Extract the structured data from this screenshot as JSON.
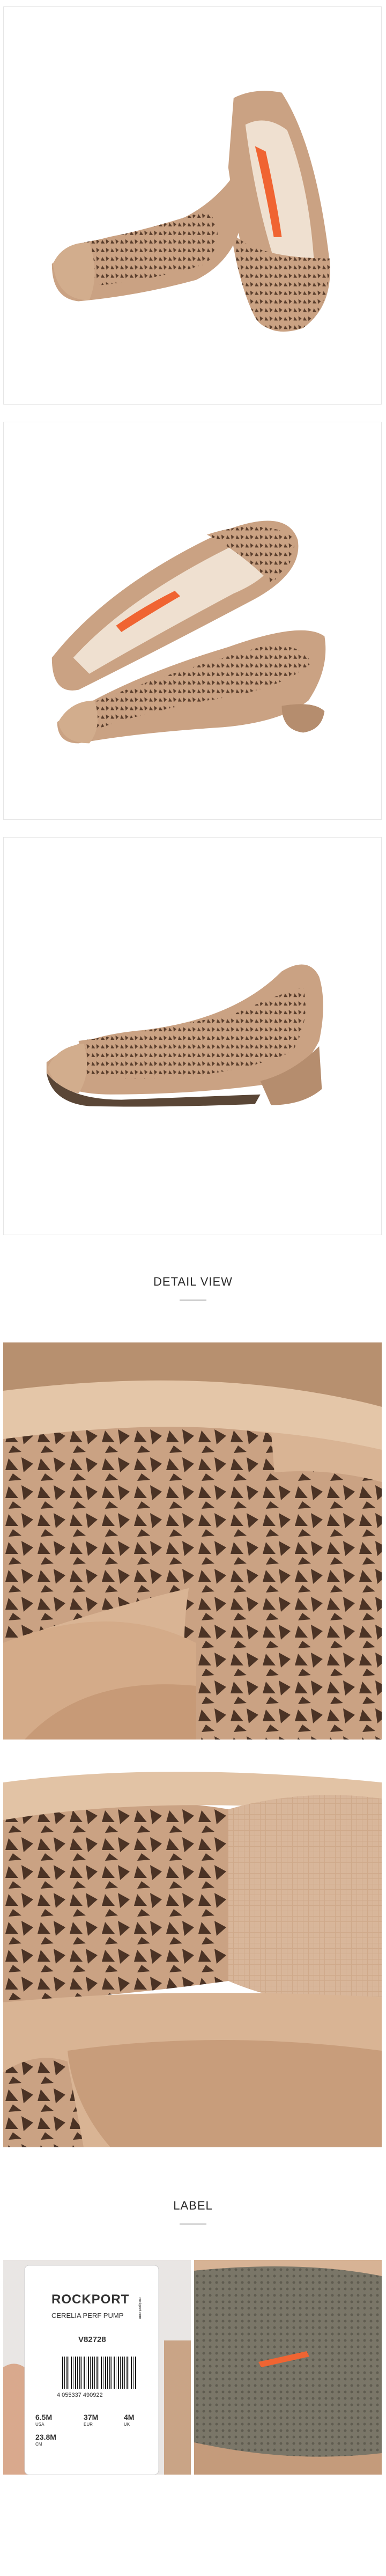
{
  "sections": {
    "detail_view_title": "DETAIL VIEW",
    "label_title": "LABEL"
  },
  "label_tag": {
    "brand": "ROCKPORT",
    "product_name": "CERELIA PERF PUMP",
    "style_code": "V82728",
    "barcode_number": "4 055337 490922",
    "size_us": "6.5M",
    "size_us_unit": "USA",
    "size_eu": "37M",
    "size_eu_unit": "EUR",
    "size_uk": "4M",
    "size_uk_unit": "UK",
    "size_cm": "23.8M",
    "size_cm_unit": "CM",
    "side_text": "rockport.com"
  },
  "colors": {
    "leather": "#caa283",
    "leather_dark": "#a97c5c",
    "leather_light": "#dcbb9d",
    "insole_accent": "#f06432",
    "outsole": "#777366",
    "background": "#ffffff"
  }
}
